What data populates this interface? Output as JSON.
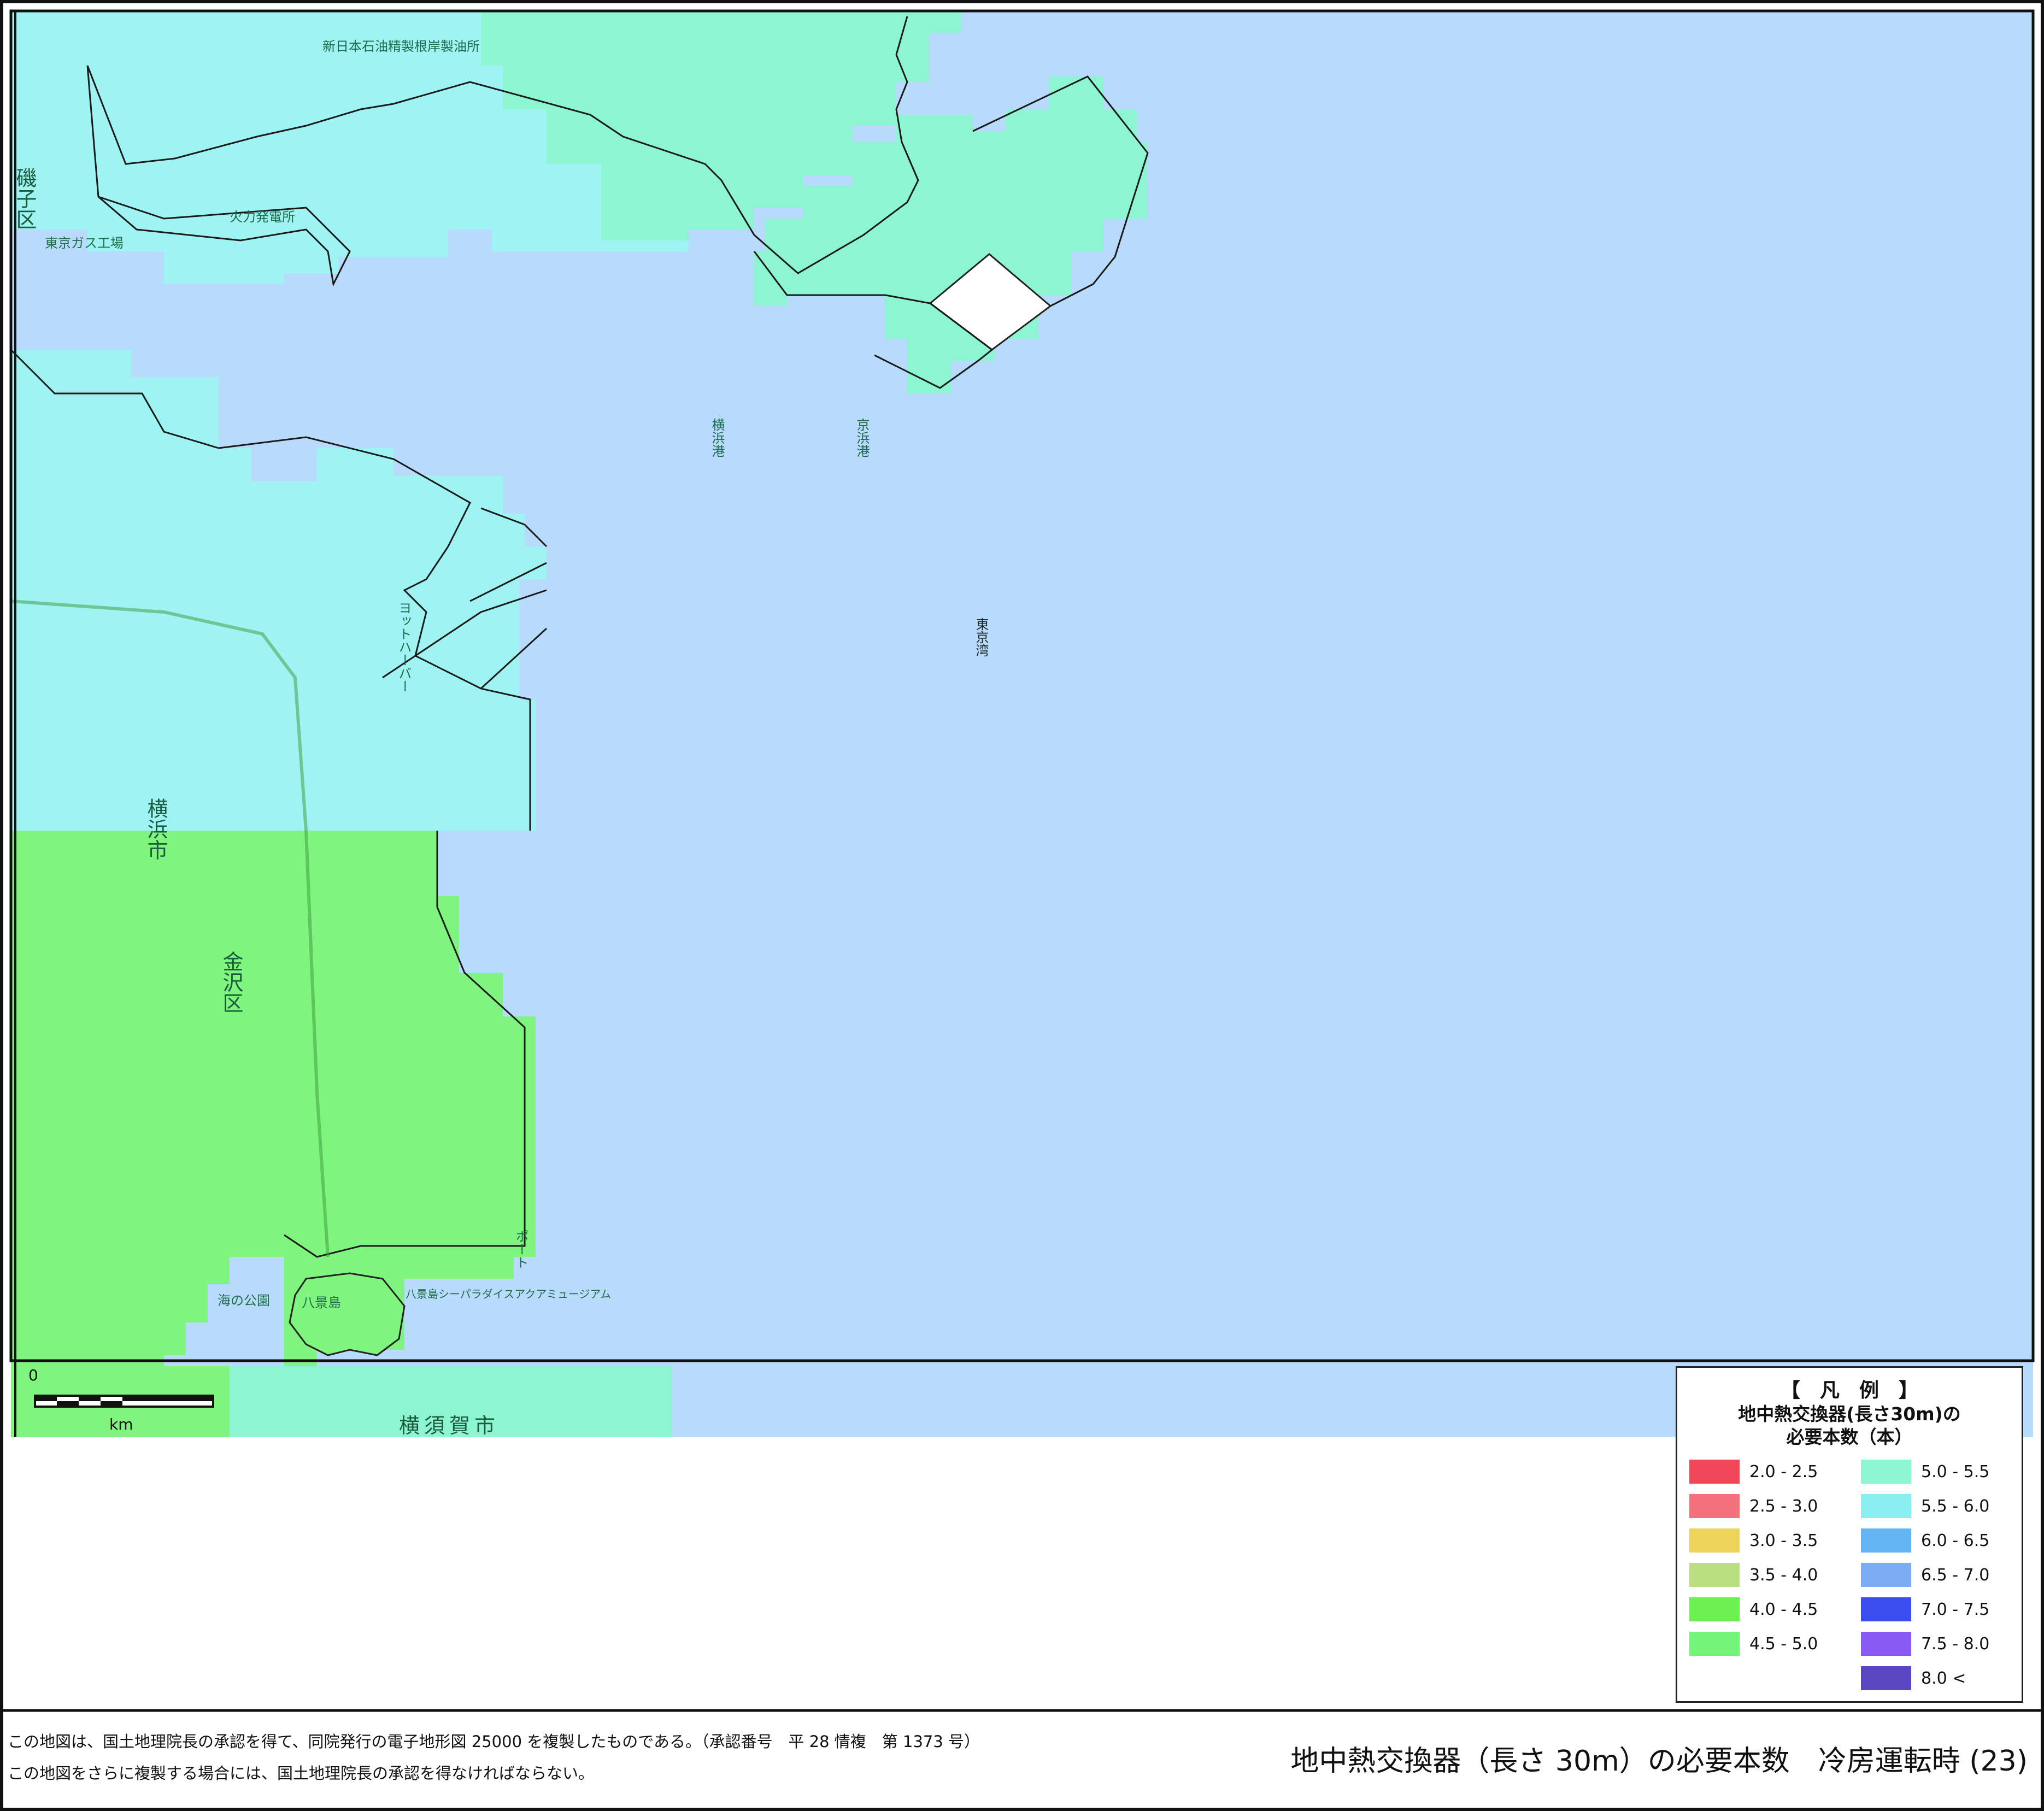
{
  "map": {
    "wards": [
      {
        "id": "isogo",
        "label": "磯子区"
      },
      {
        "id": "kanazawa",
        "label": "金沢区"
      }
    ],
    "city": "横浜市",
    "neighbor_city": "横須賀市",
    "places": [
      {
        "id": "shinnihon",
        "label": "新日本石油精製根岸製油所"
      },
      {
        "id": "tokyogas",
        "label": "東京ガス工場"
      },
      {
        "id": "denryoku",
        "label": "火力発電所"
      },
      {
        "id": "yokohama-port",
        "label": "横浜港"
      },
      {
        "id": "keihin-port",
        "label": "京浜港"
      },
      {
        "id": "tokyo-bay",
        "label": "東京湾"
      },
      {
        "id": "marina",
        "label": "ヨットハーバー"
      },
      {
        "id": "uminokoen",
        "label": "海の公園"
      },
      {
        "id": "hakkeijima",
        "label": "八景島"
      },
      {
        "id": "sea-paradise",
        "label": "八景島シーパラダイスアクアミュージアム"
      },
      {
        "id": "port",
        "label": "ポート"
      }
    ],
    "scale_bar": {
      "start_label": "0",
      "unit_label": "km"
    }
  },
  "legend": {
    "title": "【　凡　例　】",
    "subtitle_line1": "地中熱交換器(長さ30m)の",
    "subtitle_line2": "必要本数（本）",
    "items": [
      {
        "label": "2.0  -  2.5",
        "color": "#f0475a"
      },
      {
        "label": "2.5  -  3.0",
        "color": "#f4707c"
      },
      {
        "label": "3.0  -  3.5",
        "color": "#ecd35a"
      },
      {
        "label": "3.5  -  4.0",
        "color": "#b9df80"
      },
      {
        "label": "4.0  -  4.5",
        "color": "#6cf150"
      },
      {
        "label": "4.5  -  5.0",
        "color": "#74f478"
      },
      {
        "label": "5.0  -  5.5",
        "color": "#8ef5d2"
      },
      {
        "label": "5.5  -  6.0",
        "color": "#8cefef"
      },
      {
        "label": "6.0  -  6.5",
        "color": "#64b5f4"
      },
      {
        "label": "6.5  -  7.0",
        "color": "#7dacf4"
      },
      {
        "label": "7.0  -  7.5",
        "color": "#3a4ef0"
      },
      {
        "label": "7.5  -  8.0",
        "color": "#8a5af4"
      },
      {
        "label": "8.0  <",
        "color": "#5a46c0"
      }
    ]
  },
  "footer": {
    "note1": "この地図は、国土地理院長の承認を得て、同院発行の電子地形図 25000 を複製したものである。（承認番号　平 28 情複　第 1373 号）",
    "note2": "この地図をさらに複製する場合には、国土地理院長の承認を得なければならない。",
    "title": "地中熱交換器（長さ 30m）の必要本数　冷房運転時 (23)"
  },
  "colors": {
    "sea": "#b8dbfc",
    "zone_green": "#7ff47e",
    "zone_aqua": "#8ef5d2",
    "zone_cyan": "#9ff3f3",
    "frame": "#111111"
  }
}
